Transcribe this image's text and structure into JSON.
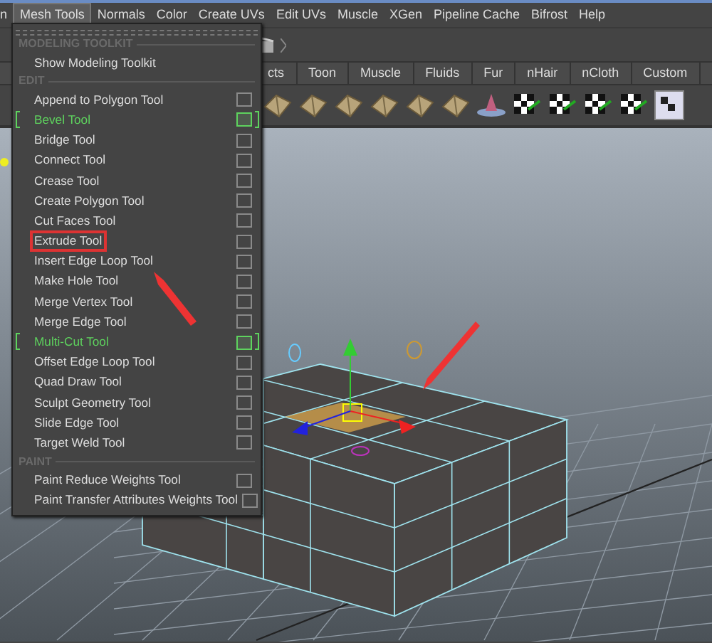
{
  "menu_bar": [
    {
      "label": "n",
      "selected": false
    },
    {
      "label": "Mesh Tools",
      "selected": true
    },
    {
      "label": "Normals",
      "selected": false
    },
    {
      "label": "Color",
      "selected": false
    },
    {
      "label": "Create UVs",
      "selected": false
    },
    {
      "label": "Edit UVs",
      "selected": false
    },
    {
      "label": "Muscle",
      "selected": false
    },
    {
      "label": "XGen",
      "selected": false
    },
    {
      "label": "Pipeline Cache",
      "selected": false
    },
    {
      "label": "Bifrost",
      "selected": false
    },
    {
      "label": "Help",
      "selected": false
    }
  ],
  "shelf_tabs": [
    "cts",
    "Toon",
    "Muscle",
    "Fluids",
    "Fur",
    "nHair",
    "nCloth",
    "Custom"
  ],
  "menu": {
    "sections": [
      {
        "title": "MODELING TOOLKIT",
        "items": [
          {
            "label": "Show Modeling Toolkit",
            "kind": "command",
            "highlighted": false,
            "boxed": false
          }
        ]
      },
      {
        "title": "EDIT",
        "items": [
          {
            "label": "Append to Polygon Tool",
            "kind": "option",
            "highlighted": false,
            "boxed": false
          },
          {
            "label": "Bevel Tool",
            "kind": "option",
            "highlighted": true,
            "boxed": false
          },
          {
            "label": "Bridge Tool",
            "kind": "option",
            "highlighted": false,
            "boxed": false
          },
          {
            "label": "Connect Tool",
            "kind": "option",
            "highlighted": false,
            "boxed": false
          },
          {
            "label": "Crease Tool",
            "kind": "option",
            "highlighted": false,
            "boxed": false
          },
          {
            "label": "Create Polygon Tool",
            "kind": "option",
            "highlighted": false,
            "boxed": false
          },
          {
            "label": "Cut Faces Tool",
            "kind": "option",
            "highlighted": false,
            "boxed": false
          },
          {
            "label": "Extrude Tool",
            "kind": "option",
            "highlighted": false,
            "boxed": true
          },
          {
            "label": "Insert Edge Loop Tool",
            "kind": "option",
            "highlighted": false,
            "boxed": false
          },
          {
            "label": "Make Hole Tool",
            "kind": "option",
            "highlighted": false,
            "boxed": false
          },
          {
            "label": "Merge Vertex Tool",
            "kind": "option",
            "highlighted": false,
            "boxed": false
          },
          {
            "label": "Merge Edge Tool",
            "kind": "option",
            "highlighted": false,
            "boxed": false
          },
          {
            "label": "Multi-Cut Tool",
            "kind": "option",
            "highlighted": true,
            "boxed": false
          },
          {
            "label": "Offset Edge Loop Tool",
            "kind": "option",
            "highlighted": false,
            "boxed": false
          },
          {
            "label": "Quad Draw Tool",
            "kind": "option",
            "highlighted": false,
            "boxed": false
          },
          {
            "label": "Sculpt Geometry Tool",
            "kind": "option",
            "highlighted": false,
            "boxed": false
          },
          {
            "label": "Slide Edge Tool",
            "kind": "option",
            "highlighted": false,
            "boxed": false
          },
          {
            "label": "Target Weld Tool",
            "kind": "option",
            "highlighted": false,
            "boxed": false
          }
        ]
      },
      {
        "title": "PAINT",
        "items": [
          {
            "label": "Paint Reduce Weights Tool",
            "kind": "option",
            "highlighted": false,
            "boxed": false
          },
          {
            "label": "Paint Transfer Attributes Weights Tool",
            "kind": "option",
            "highlighted": false,
            "boxed": false
          }
        ]
      }
    ]
  }
}
